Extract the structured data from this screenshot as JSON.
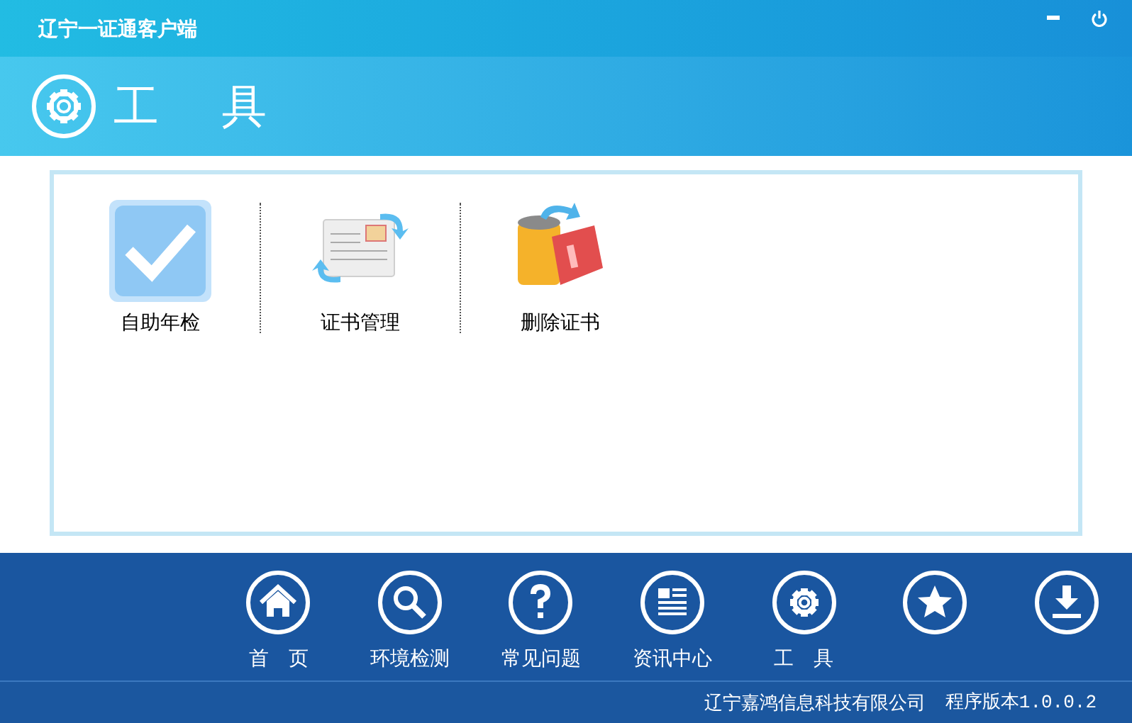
{
  "window": {
    "title": "辽宁一证通客户端"
  },
  "header": {
    "title": "工　具"
  },
  "tools": [
    {
      "label": "自助年检",
      "kind": "check",
      "selected": true
    },
    {
      "label": "证书管理",
      "kind": "card",
      "selected": false
    },
    {
      "label": "删除证书",
      "kind": "delete",
      "selected": false
    }
  ],
  "nav": [
    {
      "label": "首　页",
      "kind": "home"
    },
    {
      "label": "环境检测",
      "kind": "search"
    },
    {
      "label": "常见问题",
      "kind": "help"
    },
    {
      "label": "资讯中心",
      "kind": "news"
    },
    {
      "label": "工　具",
      "kind": "gear"
    },
    {
      "kind": "star"
    },
    {
      "kind": "download"
    }
  ],
  "status_bar": {
    "company": "辽宁嘉鸿信息科技有限公司",
    "version": "程序版本1.0.0.2"
  }
}
